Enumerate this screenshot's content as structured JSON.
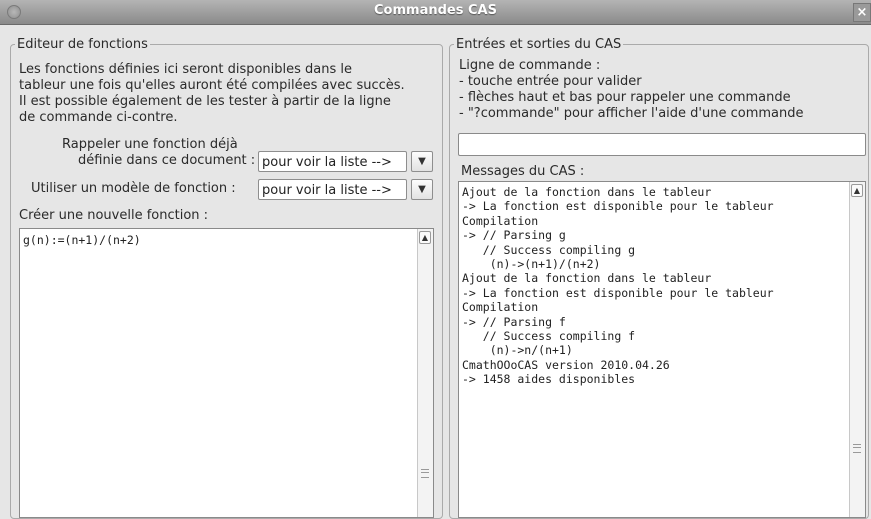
{
  "window": {
    "title": "Commandes CAS",
    "close_glyph": "×"
  },
  "left_panel": {
    "legend": "Editeur de fonctions",
    "description": [
      "Les fonctions définies ici seront disponibles dans le",
      "tableur une fois qu'elles auront été compilées avec succès.",
      "Il est possible également de les tester à partir de la ligne",
      "de commande ci-contre."
    ],
    "recall_label_line1": "Rappeler une fonction déjà",
    "recall_label_line2": "définie dans ce document :",
    "recall_combo_value": "pour voir la liste -->",
    "template_label": "Utiliser un modèle de fonction :",
    "template_combo_value": "pour voir la liste -->",
    "create_label": "Créer une nouvelle fonction :",
    "editor_content": "g(n):=(n+1)/(n+2)"
  },
  "right_panel": {
    "legend": "Entrées et sorties du CAS",
    "help_lines": [
      "Ligne de commande :",
      "- touche entrée pour valider",
      "- flèches haut et bas pour rappeler une commande",
      "- \"?commande\" pour afficher l'aide d'une commande"
    ],
    "command_input_value": "",
    "messages_label": "Messages du CAS :",
    "messages": [
      "Ajout de la fonction dans le tableur",
      "-> La fonction est disponible pour le tableur",
      "",
      "Compilation",
      "-> // Parsing g",
      "   // Success compiling g",
      "",
      "    (n)->(n+1)/(n+2)",
      "",
      "Ajout de la fonction dans le tableur",
      "-> La fonction est disponible pour le tableur",
      "",
      "Compilation",
      "-> // Parsing f",
      "   // Success compiling f",
      "",
      "    (n)->n/(n+1)",
      "",
      "CmathOOoCAS version 2010.04.26",
      "-> 1458 aides disponibles"
    ]
  },
  "icons": {
    "combo_arrow": "chevron-down-icon",
    "scroll_up": "chevron-up-icon",
    "scroll_grip": "grip-icon"
  }
}
